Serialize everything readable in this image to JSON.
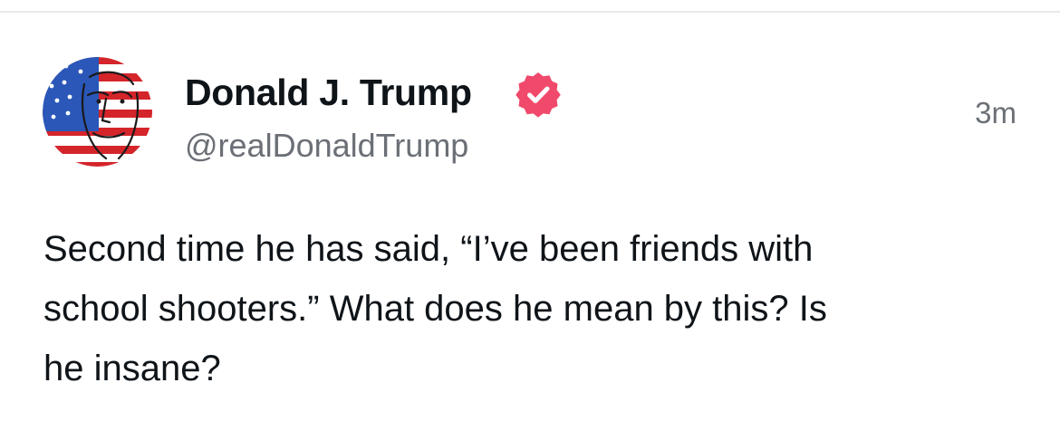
{
  "post": {
    "author": {
      "display_name": "Donald J. Trump",
      "handle": "@realDonaldTrump",
      "verified": true,
      "avatar_description_icon": "avatar-flag-portrait"
    },
    "timestamp": "3m",
    "text": "Second time he has said, “I’ve been friends with\nschool shooters.” What does he mean by this? Is\nhe insane?"
  },
  "colors": {
    "verified_badge": "#f0496b",
    "secondary_text": "#6b6f76",
    "primary_text": "#0f1419",
    "divider": "#e7e9ec"
  }
}
